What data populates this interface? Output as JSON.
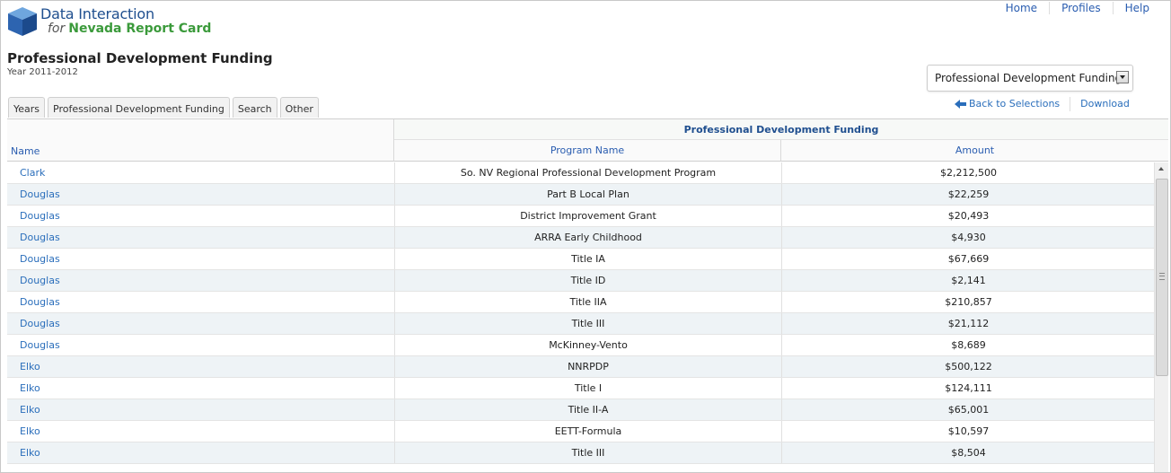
{
  "brand": {
    "line1": "Data Interaction",
    "line2_for": "for",
    "line2_name": "Nevada Report Card",
    "colors": {
      "blue": "#1f4f8f",
      "green": "#3b9a3b"
    },
    "icon": "cube-logo-icon"
  },
  "topnav": [
    {
      "label": "Home"
    },
    {
      "label": "Profiles"
    },
    {
      "label": "Help"
    }
  ],
  "page": {
    "title": "Professional Development Funding",
    "year": "Year 2011-2012"
  },
  "report_select": {
    "value": "Professional Development Funding"
  },
  "tabs": [
    {
      "label": "Years"
    },
    {
      "label": "Professional Development Funding"
    },
    {
      "label": "Search"
    },
    {
      "label": "Other"
    }
  ],
  "actions": {
    "back": "Back to Selections",
    "download": "Download",
    "back_icon": "arrow-left-icon"
  },
  "table": {
    "col_name": "Name",
    "group_header": "Professional Development Funding",
    "col_program": "Program Name",
    "col_amount": "Amount",
    "rows": [
      {
        "name": "Clark",
        "program": "So. NV Regional Professional Development Program",
        "amount": "$2,212,500"
      },
      {
        "name": "Douglas",
        "program": "Part B Local Plan",
        "amount": "$22,259"
      },
      {
        "name": "Douglas",
        "program": "District Improvement Grant",
        "amount": "$20,493"
      },
      {
        "name": "Douglas",
        "program": "ARRA Early Childhood",
        "amount": "$4,930"
      },
      {
        "name": "Douglas",
        "program": "Title IA",
        "amount": "$67,669"
      },
      {
        "name": "Douglas",
        "program": "Title ID",
        "amount": "$2,141"
      },
      {
        "name": "Douglas",
        "program": "Title IIA",
        "amount": "$210,857"
      },
      {
        "name": "Douglas",
        "program": "Title III",
        "amount": "$21,112"
      },
      {
        "name": "Douglas",
        "program": "McKinney-Vento",
        "amount": "$8,689"
      },
      {
        "name": "Elko",
        "program": "NNRPDP",
        "amount": "$500,122"
      },
      {
        "name": "Elko",
        "program": "Title I",
        "amount": "$124,111"
      },
      {
        "name": "Elko",
        "program": "Title II-A",
        "amount": "$65,001"
      },
      {
        "name": "Elko",
        "program": "EETT-Formula",
        "amount": "$10,597"
      },
      {
        "name": "Elko",
        "program": "Title III",
        "amount": "$8,504"
      }
    ]
  }
}
